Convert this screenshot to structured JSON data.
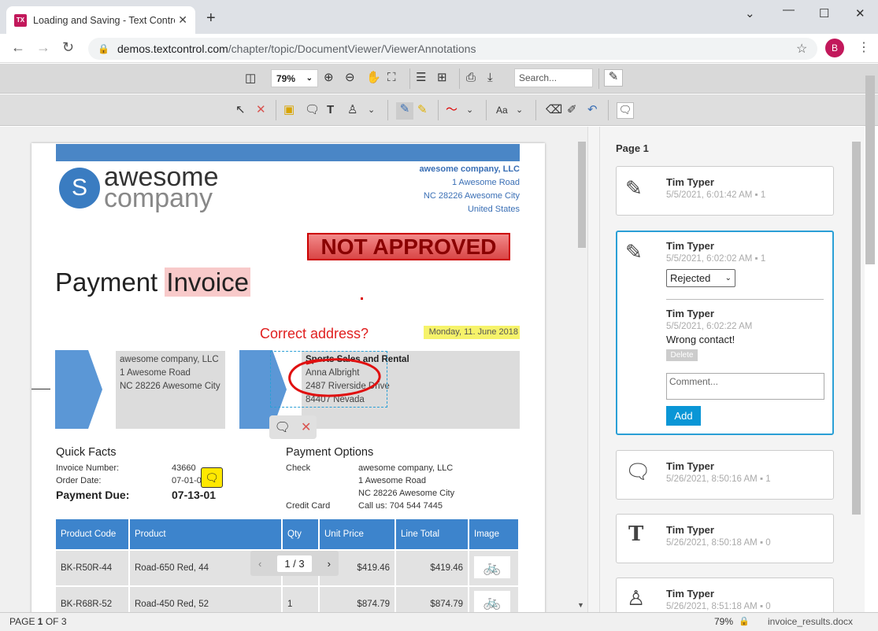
{
  "browser": {
    "tab_title": "Loading and Saving - Text Control",
    "favicon": "TX",
    "url_domain": "demos.textcontrol.com",
    "url_path": "/chapter/topic/DocumentViewer/ViewerAnnotations",
    "avatar": "B"
  },
  "toolbar": {
    "zoom": "79%",
    "search_placeholder": "Search..."
  },
  "document": {
    "logo_letter": "S",
    "logo_line1": "awesome",
    "logo_line2": "company",
    "company_address": [
      "awesome company, LLC",
      "1 Awesome Road",
      "NC 28226 Awesome City",
      "United States"
    ],
    "stamp": "NOT APPROVED",
    "title_plain": "Payment ",
    "title_highlight": "Invoice",
    "annotation_text": "Correct address?",
    "date": "Monday, 11. June 2018",
    "from_address": [
      "awesome company, LLC",
      "1 Awesome Road",
      "NC 28226 Awesome City"
    ],
    "to_address": [
      "Sports Sales and Rental",
      "Anna Albright",
      "2487 Riverside Drive",
      "84407 Nevada"
    ],
    "quick_facts": {
      "heading": "Quick Facts",
      "invoice_label": "Invoice Number:",
      "invoice_value": "43660",
      "order_label": "Order Date:",
      "order_value": "07-01-0",
      "due_label": "Payment Due:",
      "due_value": "07-13-01"
    },
    "payment_options": {
      "heading": "Payment Options",
      "check_label": "Check",
      "check_lines": [
        "awesome company, LLC",
        "1 Awesome Road",
        "NC 28226 Awesome City"
      ],
      "cc_label": "Credit Card",
      "cc_value": "Call us: 704 544 7445"
    },
    "table": {
      "headers": [
        "Product Code",
        "Product",
        "Qty",
        "Unit Price",
        "Line Total",
        "Image"
      ],
      "rows": [
        [
          "BK-R50R-44",
          "Road-650 Red, 44",
          "",
          "$419.46",
          "$419.46"
        ],
        [
          "BK-R68R-52",
          "Road-450 Red, 52",
          "1",
          "$874.79",
          "$874.79"
        ]
      ]
    },
    "pager": "1 / 3"
  },
  "panel": {
    "page_label": "Page 1",
    "cards": [
      {
        "name": "Tim Typer",
        "date": "5/5/2021, 6:01:42 AM",
        "count": "1",
        "icon": "pen-icon"
      },
      {
        "name": "Tim Typer",
        "date": "5/5/2021, 6:02:02 AM",
        "count": "1",
        "icon": "pen-icon",
        "status": "Rejected",
        "reply_name": "Tim Typer",
        "reply_date": "5/5/2021, 6:02:22 AM",
        "reply_text": "Wrong contact!",
        "delete_label": "Delete",
        "comment_placeholder": "Comment...",
        "add_label": "Add"
      },
      {
        "name": "Tim Typer",
        "date": "5/26/2021, 8:50:16 AM",
        "count": "1",
        "icon": "comment-icon"
      },
      {
        "name": "Tim Typer",
        "date": "5/26/2021, 8:50:18 AM",
        "count": "0",
        "icon": "text-icon"
      },
      {
        "name": "Tim Typer",
        "date": "5/26/2021, 8:51:18 AM",
        "count": "0",
        "icon": "stamp-icon"
      }
    ]
  },
  "status": {
    "page_prefix": "PAGE ",
    "page_current": "1",
    "page_suffix": " OF 3",
    "zoom": "79%",
    "filename": "invoice_results.docx"
  },
  "colors": {
    "accent": "#2a9fd6",
    "header_blue": "#3d84cc",
    "stamp_red": "#c00000"
  }
}
